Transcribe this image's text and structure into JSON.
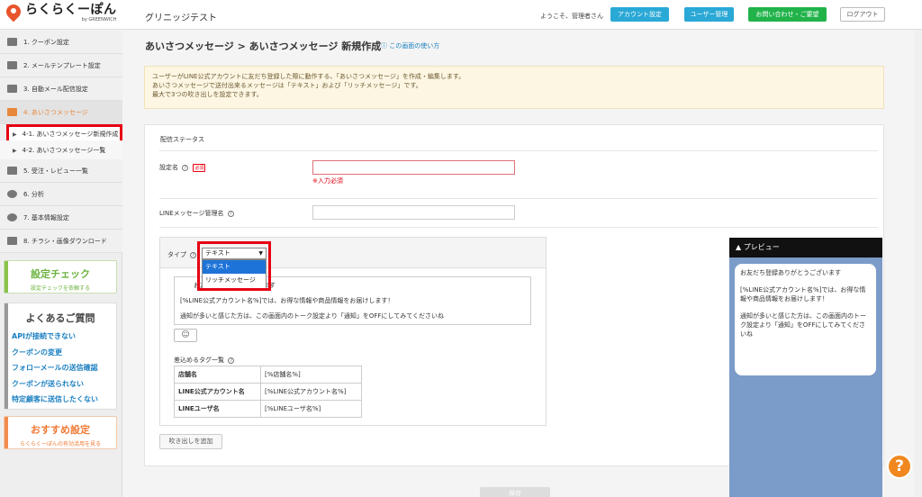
{
  "header": {
    "logo_text": "らくらくーぽん",
    "logo_sub": "by GREENWICH",
    "app_title": "グリニッジテスト",
    "welcome": "ようこそ、管理者さん",
    "buttons": {
      "account": "アカウント設定",
      "users": "ユーザー管理",
      "contact": "お問い合わせ・ご要望",
      "logout": "ログアウト"
    },
    "colors": {
      "blue": "#2aa8d6",
      "green": "#21b34a"
    }
  },
  "sidebar": {
    "items": [
      {
        "label": "1. クーポン設定",
        "icon": "coupon-icon"
      },
      {
        "label": "2. メールテンプレート設定",
        "icon": "mail-icon"
      },
      {
        "label": "3. 自動メール配信設定",
        "icon": "auto-mail-icon"
      },
      {
        "label": "4. あいさつメッセージ",
        "icon": "greeting-icon"
      },
      {
        "label": "5. 受注・レビュー一覧",
        "icon": "list-icon"
      },
      {
        "label": "6. 分析",
        "icon": "chart-pie-icon"
      },
      {
        "label": "7. 基本情報設定",
        "icon": "gear-icon"
      },
      {
        "label": "8. チラシ・画像ダウンロード",
        "icon": "download-icon"
      }
    ],
    "sub_items": [
      {
        "label": "4-1. あいさつメッセージ新規作成"
      },
      {
        "label": "4-2. あいさつメッセージ一覧"
      }
    ],
    "check_box": {
      "title": "設定チェック",
      "sub": "設定チェックを依頼する"
    },
    "faq": {
      "title": "よくあるご質問",
      "links": [
        "APIが接続できない",
        "クーポンの変更",
        "フォローメールの送信確認",
        "クーポンが送られない",
        "特定顧客に送信したくない"
      ]
    },
    "recommend": {
      "title": "おすすめ設定",
      "sub": "らくらくーぽんの有効活用を見る"
    },
    "accent_color": "#e8873c"
  },
  "main": {
    "title": "あいさつメッセージ > あいさつメッセージ 新規作成",
    "help_link": "この画面の使い方",
    "info": [
      "ユーザーがLINE公式アカウントに友だち登録した際に動作する、「あいさつメッセージ」を作成・編集します。",
      "あいさつメッセージで送付出来るメッセージは「テキスト」および「リッチメッセージ」です。",
      "最大で3つの吹き出しを設定できます。"
    ],
    "section_title": "配信ステータス",
    "setting_name_label": "設定名",
    "required_badge": "必須",
    "required_error": "※入力必須",
    "line_manage_label": "LINEメッセージ管理名",
    "type_label": "タイプ",
    "type_selected": "テキスト",
    "type_options": [
      "テキスト",
      "リッチメッセージ"
    ],
    "message_lines": [
      "お友だ　　　　　　　　ます",
      "[%LINE公式アカウント名%]では、お得な情報や商品情報をお届けします！",
      "通知が多いと感じた方は、この画面内のトーク設定より「通知」をOFFにしてみてくださいね"
    ],
    "tag_title": "差込めるタグ一覧",
    "tags": [
      {
        "key": "店舗名",
        "value": "[%店舗名%]"
      },
      {
        "key": "LINE公式アカウント名",
        "value": "[%LINE公式アカウント名%]"
      },
      {
        "key": "LINEユーザ名",
        "value": "[%LINEユーザ名%]"
      }
    ],
    "add_bubble": "吹き出しを追加",
    "save": "保存"
  },
  "preview": {
    "title": "▲ プレビュー",
    "bubble": [
      "お友だち登録ありがとうございます",
      "[%LINE公式アカウント名%]では、お得な情報や商品情報をお届けします！",
      "通知が多いと感じた方は、この画面内のトーク設定より「通知」をOFFにしてみてくださいね"
    ],
    "bg_color": "#7b9bc9"
  }
}
